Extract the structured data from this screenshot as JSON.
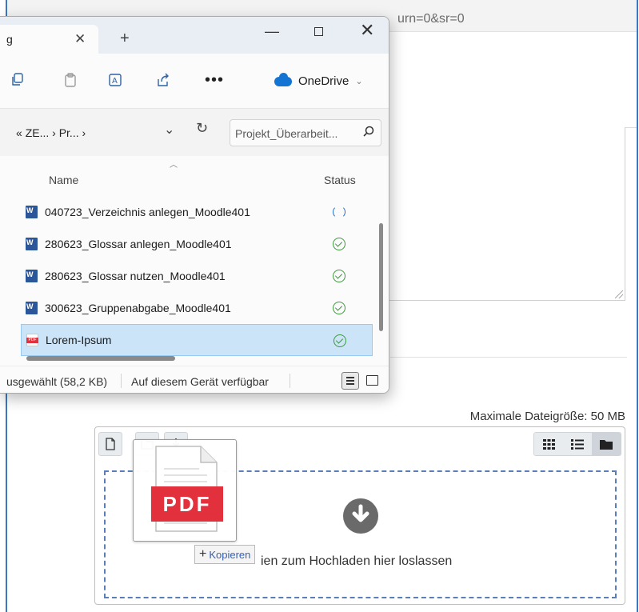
{
  "browser": {
    "url_fragment": "urn=0&sr=0"
  },
  "moodle": {
    "max_file_size": "Maximale Dateigröße: 50 MB",
    "dropzone_text": "ien zum Hochladen hier loslassen",
    "copy_tooltip": "Kopieren",
    "drag_thumbnail_label": "PDF"
  },
  "explorer": {
    "tab_title": "g",
    "address": {
      "breadcrumb": [
        "«",
        "ZE...",
        "›",
        "Pr...",
        "›"
      ],
      "search_placeholder": "Projekt_Überarbeit..."
    },
    "onedrive_label": "OneDrive",
    "columns": {
      "name": "Name",
      "status": "Status"
    },
    "files": [
      {
        "name": "040723_Verzeichnis anlegen_Moodle401",
        "type": "word",
        "status": "syncing",
        "selected": false
      },
      {
        "name": "280623_Glossar anlegen_Moodle401",
        "type": "word",
        "status": "available",
        "selected": false
      },
      {
        "name": "280623_Glossar nutzen_Moodle401",
        "type": "word",
        "status": "available",
        "selected": false
      },
      {
        "name": "300623_Gruppenabgabe_Moodle401",
        "type": "word",
        "status": "available",
        "selected": false
      },
      {
        "name": "Lorem-Ipsum",
        "type": "pdf",
        "status": "available",
        "selected": true
      }
    ],
    "statusbar": {
      "selected": "usgewählt (58,2 KB)",
      "availability": "Auf diesem Gerät verfügbar"
    }
  },
  "colors": {
    "accent": "#3a78c2",
    "selection": "#cce4f7",
    "pdf_red": "#e2313d",
    "word_blue": "#2b579a",
    "ok_green": "#3a9a3a",
    "onedrive_blue": "#1474d4"
  }
}
